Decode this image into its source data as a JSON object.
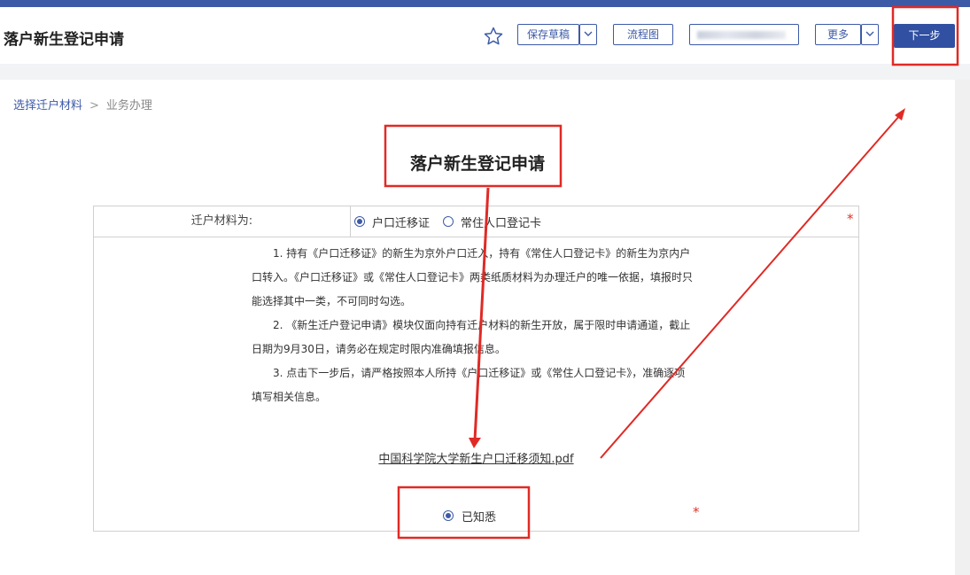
{
  "header": {
    "title": "落户新生登记申请",
    "buttons": {
      "save_draft": "保存草稿",
      "flowchart": "流程图",
      "more": "更多",
      "next": "下一步"
    }
  },
  "breadcrumb": {
    "items": [
      "选择迁户材料",
      "业务办理"
    ],
    "separator": ">"
  },
  "form": {
    "title": "落户新生登记申请",
    "material_label": "迁户材料为:",
    "options": [
      {
        "label": "户口迁移证",
        "checked": true
      },
      {
        "label": "常住人口登记卡",
        "checked": false
      }
    ],
    "required_mark": "*",
    "notice": [
      "1. 持有《户口迁移证》的新生为京外户口迁入，持有《常住人口登记卡》的新生为京内户口转入。《户口迁移证》或《常住人口登记卡》两类纸质材料为办理迁户的唯一依据，填报时只能选择其中一类，不可同时勾选。",
      "2. 《新生迁户登记申请》模块仅面向持有迁户材料的新生开放，属于限时申请通道，截止日期为9月30日，请务必在规定时限内准确填报信息。",
      "3. 点击下一步后，请严格按照本人所持《户口迁移证》或《常住人口登记卡》，准确逐项填写相关信息。"
    ],
    "pdf_link": "中国科学院大学新生户口迁移须知.pdf",
    "acknowledge": {
      "label": "已知悉",
      "checked": true
    }
  },
  "colors": {
    "primary": "#3d5aa7",
    "next_button": "#3150a2",
    "required": "#e0322b",
    "annotation": "#e02a25"
  },
  "icons": {
    "favorite": "star-icon",
    "dropdown": "chevron-down-icon"
  }
}
